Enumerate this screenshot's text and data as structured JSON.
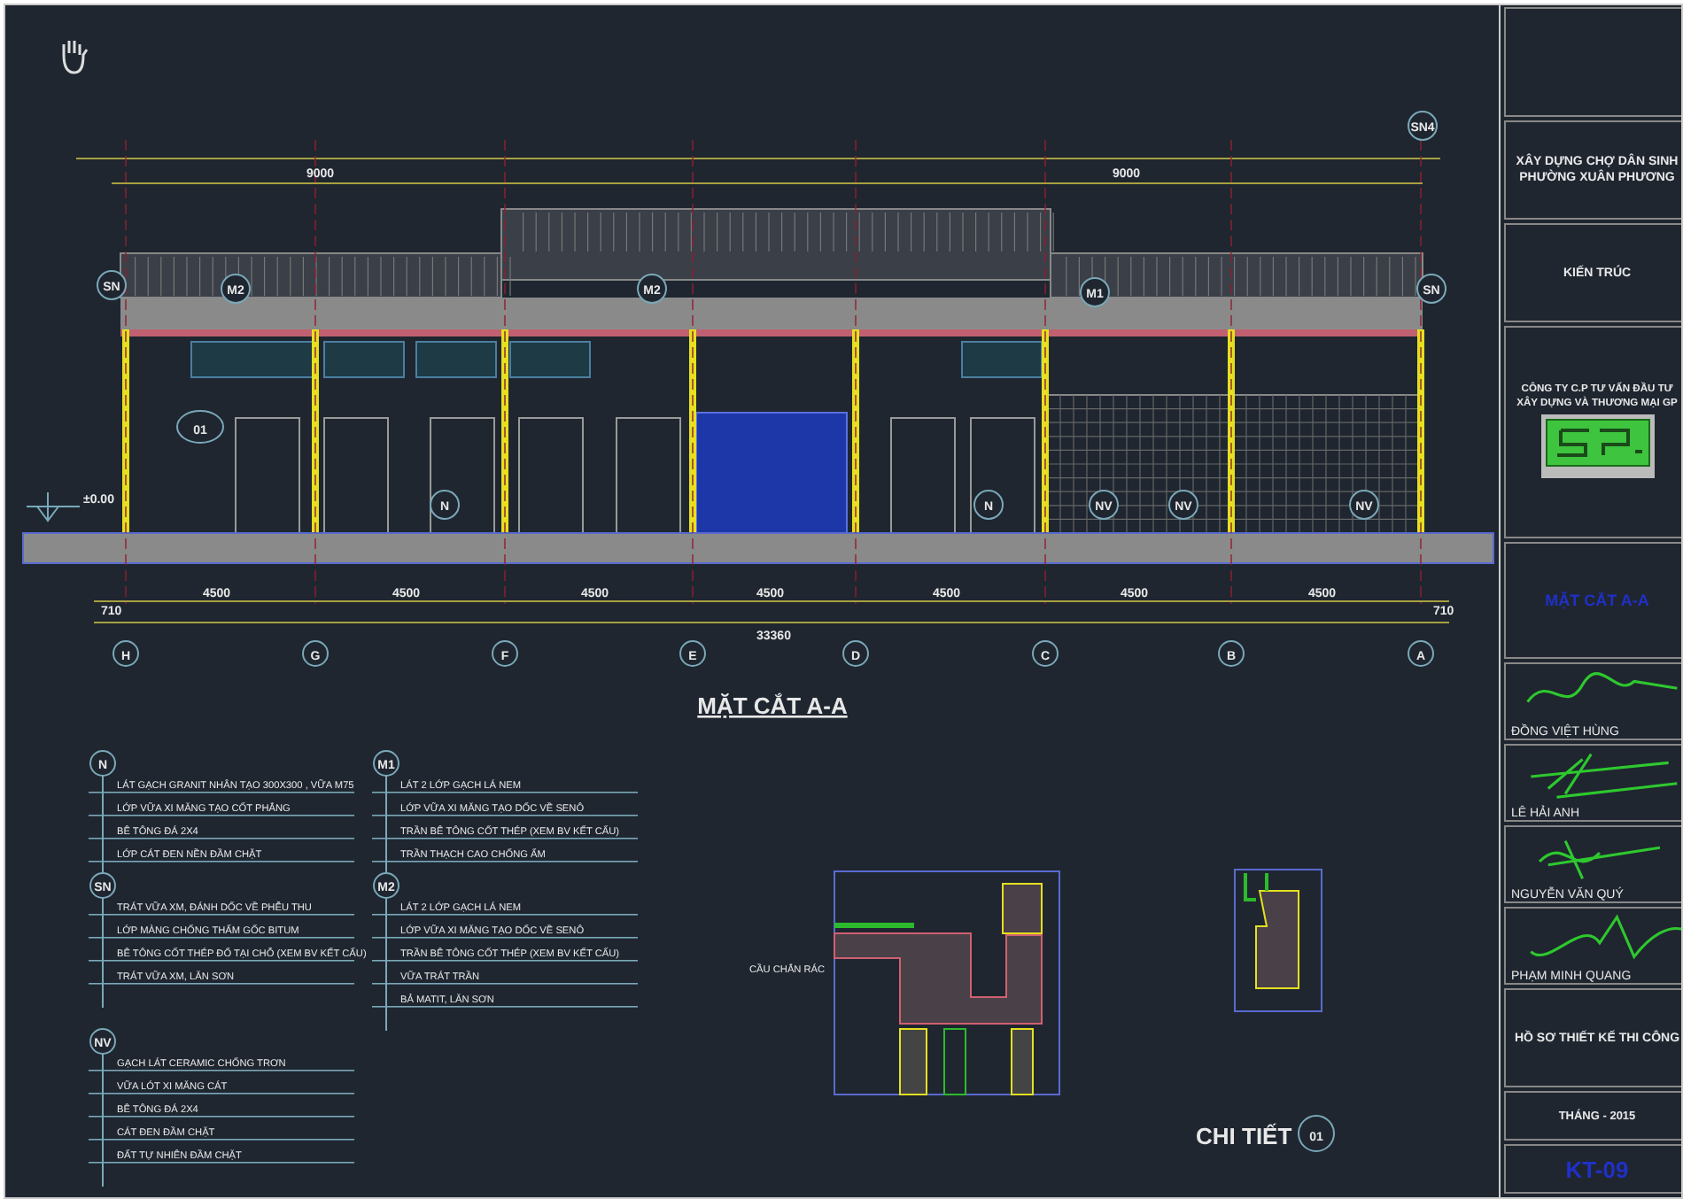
{
  "section": {
    "title": "MẶT CẮT A-A",
    "level_label": "±0.00",
    "axes": [
      "H",
      "G",
      "F",
      "E",
      "D",
      "C",
      "B",
      "A"
    ],
    "edge_dims": [
      "710",
      "710"
    ],
    "bay_dims": [
      "4500",
      "4500",
      "4500",
      "4500",
      "4500",
      "4500",
      "4500"
    ],
    "total_dim": "33360",
    "top_dims": [
      "9000",
      "9000"
    ],
    "tags": [
      "SN",
      "M2",
      "M2",
      "M1",
      "N",
      "N",
      "NV",
      "NV",
      "NV",
      "SN",
      "SN4"
    ],
    "callout": "01"
  },
  "legend": [
    {
      "tag": "N",
      "lines": [
        "LÁT GẠCH GRANIT NHÂN TẠO 300X300 , VỮA M75",
        "LỚP VỮA XI MĂNG TẠO CỐT PHẲNG",
        "BÊ TÔNG ĐÁ 2X4",
        "LỚP CÁT ĐEN NỀN ĐẦM CHẶT"
      ]
    },
    {
      "tag": "M1",
      "lines": [
        "LÁT 2 LỚP GẠCH LÁ NEM",
        "LỚP VỮA XI MĂNG TẠO DỐC VỀ SENÔ",
        "TRẦN BÊ TÔNG CỐT THÉP (XEM BV KẾT CẤU)",
        "TRẦN THẠCH CAO CHỐNG ẨM"
      ]
    },
    {
      "tag": "SN",
      "lines": [
        "TRÁT VỮA XM, ĐÁNH DỐC VỀ PHỄU THU",
        "LỚP MÀNG CHỐNG THẤM GỐC BITUM",
        "BÊ TÔNG CỐT THÉP ĐỔ TẠI CHỖ (XEM BV KẾT CẤU)",
        "TRÁT VỮA XM, LĂN SƠN"
      ]
    },
    {
      "tag": "M2",
      "lines": [
        "LÁT 2 LỚP GẠCH LÁ NEM",
        "LỚP VỮA XI MĂNG TẠO DỐC VỀ SENÔ",
        "TRẦN BÊ TÔNG CỐT THÉP (XEM BV KẾT CẤU)",
        "VỮA TRÁT TRẦN",
        "BẢ MATIT, LĂN SƠN"
      ]
    },
    {
      "tag": "NV",
      "lines": [
        "GẠCH LÁT CERAMIC CHỐNG TRƠN",
        "VỮA LÓT XI MĂNG CÁT",
        "BÊ TÔNG ĐÁ 2X4",
        "CÁT ĐEN ĐẦM CHẶT",
        "ĐẤT TỰ NHIÊN ĐẦM CHẶT"
      ]
    }
  ],
  "detail": {
    "note": "CẦU CHẮN RÁC",
    "label": "CHI TIẾT",
    "number": "01"
  },
  "title_block": [
    {
      "kind": "text",
      "lines": [
        "XÂY DỰNG CHỢ DÂN SINH",
        "PHƯỜNG XUÂN PHƯƠNG"
      ]
    },
    {
      "kind": "text",
      "lines": [
        "KIẾN TRÚC"
      ]
    },
    {
      "kind": "logo",
      "lines": [
        "CÔNG TY C.P TƯ VẤN ĐẦU TƯ",
        "XÂY DỰNG VÀ THƯƠNG MẠI GP"
      ]
    },
    {
      "kind": "title",
      "lines": [
        "MẶT CẮT A-A"
      ]
    },
    {
      "kind": "signature",
      "lines": [
        "ĐỒNG VIỆT HÙNG"
      ]
    },
    {
      "kind": "signature",
      "lines": [
        "LÊ HẢI ANH"
      ]
    },
    {
      "kind": "signature",
      "lines": [
        "NGUYỄN VĂN QUÝ"
      ]
    },
    {
      "kind": "signature",
      "lines": [
        "PHẠM MINH QUANG"
      ]
    },
    {
      "kind": "text",
      "lines": [
        "HỒ SƠ THIẾT KẾ THI CÔNG"
      ]
    },
    {
      "kind": "small",
      "lines": [
        "THÁNG - 2015"
      ]
    },
    {
      "kind": "code",
      "lines": [
        "KT-09"
      ]
    }
  ]
}
